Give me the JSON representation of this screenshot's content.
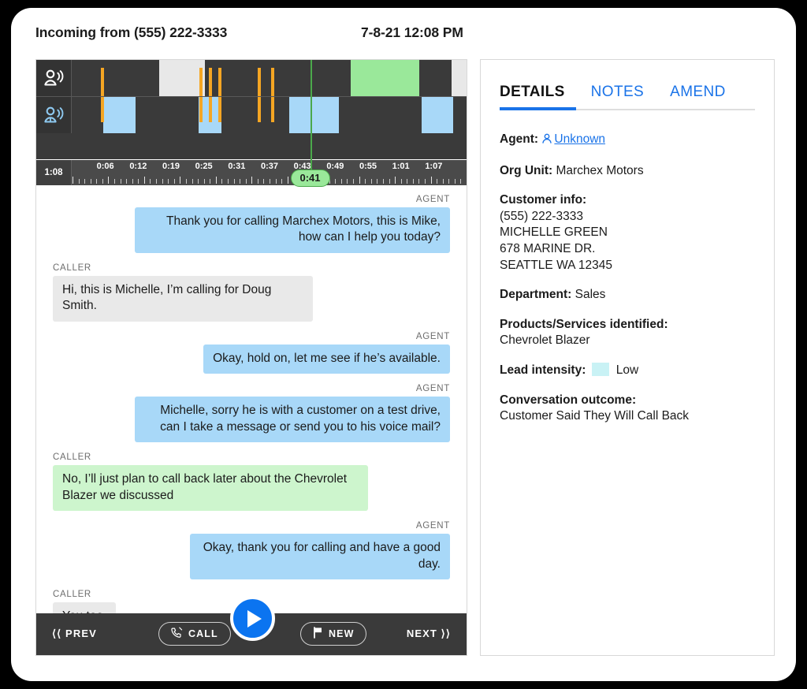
{
  "header": {
    "title": "Incoming from (555) 222-3333",
    "datetime": "7-8-21 12:08 PM"
  },
  "player": {
    "duration": "1:08",
    "current_time": "0:41",
    "playhead_percent": 60.3,
    "agent_row_icon": "agent-speaking-icon",
    "caller_row_icon": "caller-speaking-icon",
    "tick_labels": [
      "0:06",
      "0:12",
      "0:19",
      "0:25",
      "0:31",
      "0:37",
      "0:43",
      "0:49",
      "0:55",
      "1:01",
      "1:07"
    ],
    "colors": {
      "agent_segment": "#e8e8e8",
      "caller_segment": "#a8d8f8",
      "highlight_segment": "#9ae89a",
      "marker_bar": "#f5a623",
      "playhead": "#4ba84b",
      "track_bg": "#3a3a3a"
    },
    "agent_segments": [
      {
        "left_pct": 22.0,
        "width_pct": 11.5,
        "kind": "white"
      },
      {
        "left_pct": 70.5,
        "width_pct": 17.5,
        "kind": "green"
      },
      {
        "left_pct": 96.2,
        "width_pct": 3.8,
        "kind": "white"
      }
    ],
    "caller_segments": [
      {
        "left_pct": 7.8,
        "width_pct": 8.2,
        "kind": "blue"
      },
      {
        "left_pct": 32.0,
        "width_pct": 5.8,
        "kind": "blue"
      },
      {
        "left_pct": 55.0,
        "width_pct": 12.5,
        "kind": "blue"
      },
      {
        "left_pct": 88.5,
        "width_pct": 8.0,
        "kind": "blue"
      }
    ],
    "agent_markers_pct": [
      7.2,
      32.2,
      34.6,
      37.0,
      47.0,
      50.4
    ],
    "caller_markers_pct": [
      7.2,
      32.2,
      34.6,
      37.0,
      47.0,
      50.4
    ]
  },
  "transcript": [
    {
      "speaker": "AGENT",
      "side": "right",
      "style": "agent",
      "text": "Thank you for calling Marchex Motors, this is Mike, how can I help you today?"
    },
    {
      "speaker": "CALLER",
      "side": "left",
      "style": "caller",
      "text": "Hi, this is Michelle, I’m calling for Doug Smith."
    },
    {
      "speaker": "AGENT",
      "side": "right",
      "style": "agent",
      "text": "Okay, hold on, let me see if he’s available."
    },
    {
      "speaker": "AGENT",
      "side": "right",
      "style": "agent",
      "text": "Michelle, sorry he is with a customer on a test drive, can I take a message or send you to his voice mail?"
    },
    {
      "speaker": "CALLER",
      "side": "left",
      "style": "caller-green",
      "text": "No, I’ll just plan to call back later about the Chevrolet Blazer we discussed"
    },
    {
      "speaker": "AGENT",
      "side": "right",
      "style": "agent",
      "text": "Okay, thank you for calling and have a good day."
    },
    {
      "speaker": "CALLER",
      "side": "left",
      "style": "caller",
      "text": "You too."
    }
  ],
  "toolbar": {
    "prev_label": "⟨⟨ PREV",
    "call_label": "CALL",
    "new_label": "NEW",
    "next_label": "NEXT ⟩⟩",
    "play_label": "play-button",
    "accent": "#0b74f0"
  },
  "details": {
    "tabs": [
      {
        "label": "DETAILS",
        "active": true
      },
      {
        "label": "NOTES",
        "active": false
      },
      {
        "label": "AMEND",
        "active": false
      }
    ],
    "agent_label": "Agent:",
    "agent_value": "Unknown",
    "org_unit_label": "Org Unit:",
    "org_unit_value": "Marchex Motors",
    "customer_info_label": "Customer info:",
    "customer_info_lines": [
      "(555) 222-3333",
      "MICHELLE GREEN",
      "678 MARINE DR.",
      "SEATTLE WA 12345"
    ],
    "department_label": "Department:",
    "department_value": "Sales",
    "products_label": "Products/Services identified:",
    "products_value": "Chevrolet Blazer",
    "lead_intensity_label": "Lead intensity:",
    "lead_intensity_value": "Low",
    "lead_intensity_color": "#c9f2f5",
    "outcome_label": "Conversation outcome:",
    "outcome_value": "Customer Said They Will Call Back"
  }
}
